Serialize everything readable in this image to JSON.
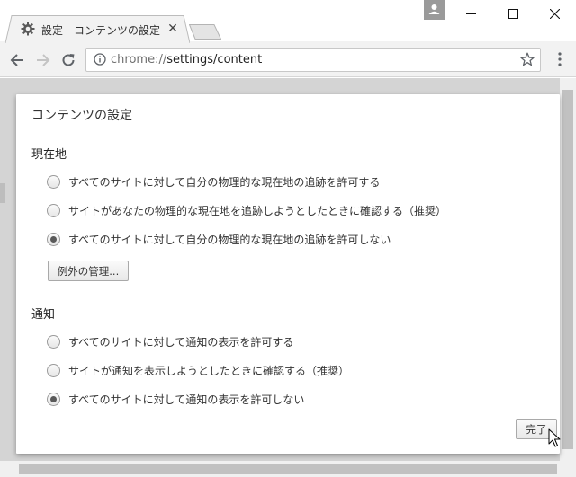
{
  "tab": {
    "title": "設定 - コンテンツの設定",
    "close_glyph": "✕"
  },
  "window": {
    "minimize_glyph": "—",
    "maximize_glyph": "☐",
    "close_glyph": "✕"
  },
  "toolbar": {
    "url_scheme": "chrome://",
    "url_path": "settings/content"
  },
  "dialog": {
    "title": "コンテンツの設定",
    "sections": [
      {
        "title": "現在地",
        "options": [
          {
            "label": "すべてのサイトに対して自分の物理的な現在地の追跡を許可する",
            "checked": false
          },
          {
            "label": "サイトがあなたの物理的な現在地を追跡しようとしたときに確認する（推奨）",
            "checked": false
          },
          {
            "label": "すべてのサイトに対して自分の物理的な現在地の追跡を許可しない",
            "checked": true
          }
        ],
        "button": "例外の管理..."
      },
      {
        "title": "通知",
        "options": [
          {
            "label": "すべてのサイトに対して通知の表示を許可する",
            "checked": false
          },
          {
            "label": "サイトが通知を表示しようとしたときに確認する（推奨）",
            "checked": false
          },
          {
            "label": "すべてのサイトに対して通知の表示を許可しない",
            "checked": true
          }
        ]
      }
    ],
    "done_button": "完了"
  },
  "colors": {
    "overlay": "#d4d4d4",
    "toolbar": "#f2f2f2",
    "dialog": "#ffffff"
  },
  "icons": [
    "gear-icon",
    "close-icon",
    "back-icon",
    "forward-icon",
    "reload-icon",
    "info-icon",
    "star-icon",
    "menu-icon",
    "profile-icon",
    "minimize-icon",
    "maximize-icon",
    "mouse-cursor-icon"
  ]
}
